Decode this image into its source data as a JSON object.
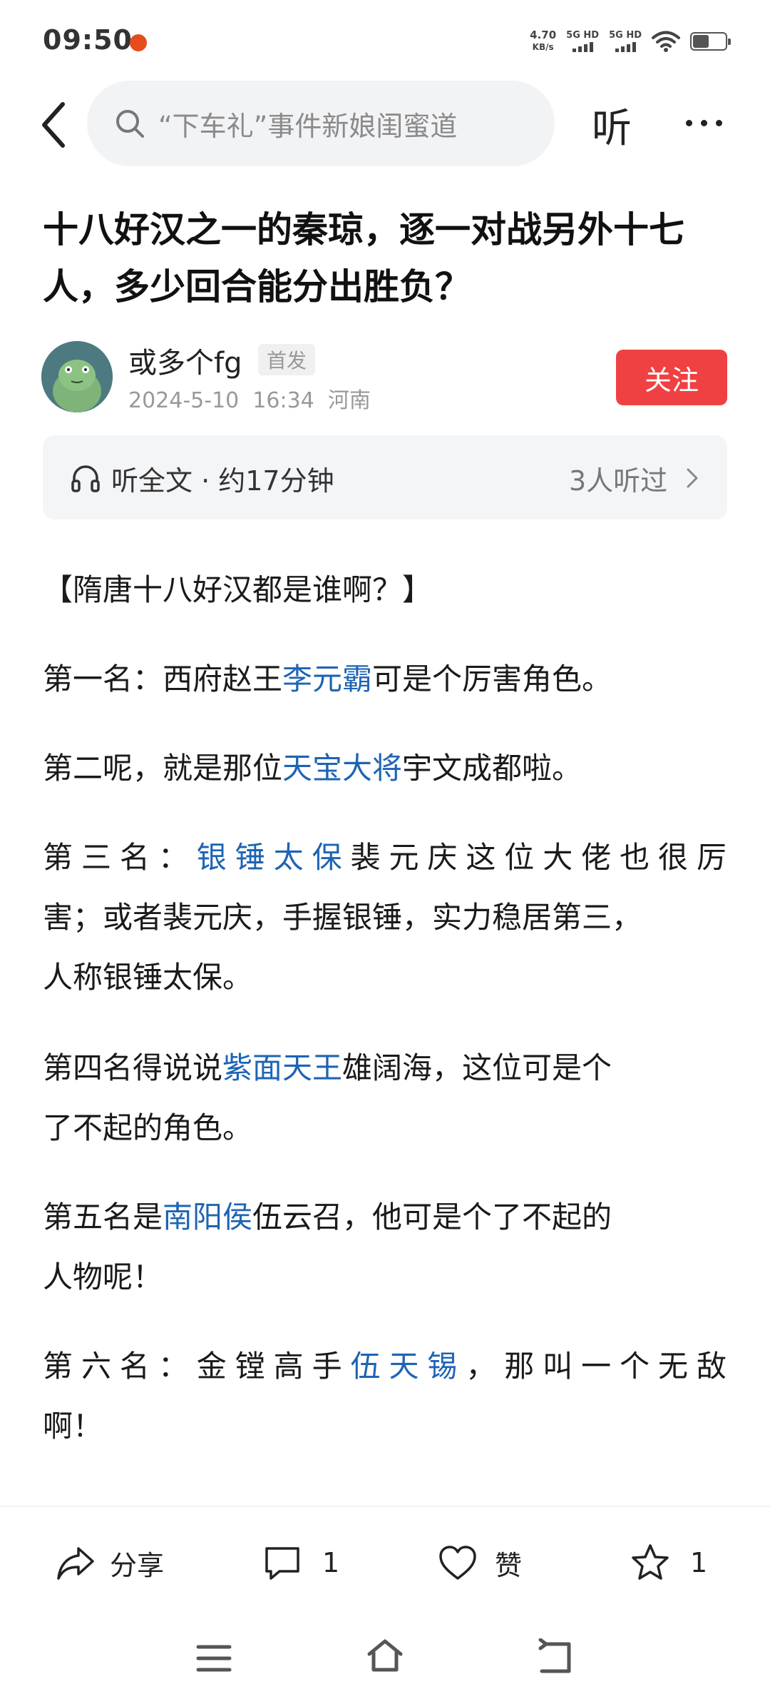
{
  "status": {
    "time": "09:50",
    "speed_value": "4.70",
    "speed_unit": "KB/s",
    "sim1": "5G HD",
    "sim2": "5G HD"
  },
  "nav": {
    "search_text": "“下车礼”事件新娘闺蜜道",
    "listen_label": "听"
  },
  "article": {
    "title": "十八好汉之一的秦琼，逐一对战另外十七人，多少回合能分出胜负？",
    "author": "或多个fg",
    "first_tag": "首发",
    "date": "2024-5-10",
    "time": "16:34",
    "location": "河南",
    "follow_label": "关注"
  },
  "listen_bar": {
    "label": "听全文 · 约17分钟",
    "listeners": "3人听过"
  },
  "body": {
    "heading": "【隋唐十八好汉都是谁啊？】",
    "p1": {
      "pre": "第一名：西府赵王",
      "link": "李元霸",
      "post": "可是个厉害角色。"
    },
    "p2": {
      "pre": "第二呢，就是那位",
      "link": "天宝大将",
      "post": "宇文成都啦。"
    },
    "p3": {
      "line1_pre": "第三名：",
      "line1_link": "银锤太保",
      "line1_post": "裴元庆这位大佬也很厉",
      "line2": "害；或者裴元庆，手握银锤，实力稳居第三，",
      "line3": "人称银锤太保。"
    },
    "p4": {
      "line1_pre": "第四名得说说",
      "line1_link": "紫面天王",
      "line1_post": "雄阔海，这位可是个",
      "line2": "了不起的角色。"
    },
    "p5": {
      "line1_pre": "第五名是",
      "line1_link": "南阳侯",
      "line1_post": "伍云召，他可是个了不起的",
      "line2": "人物呢！"
    },
    "p6": {
      "line1_pre": "第六名：金镗高手",
      "line1_link": "伍天锡",
      "line1_post": "，那叫一个无敌",
      "line2": "啊！"
    }
  },
  "actions": {
    "share_label": "分享",
    "comment_count": "1",
    "like_label": "赞",
    "favorite_count": "1"
  },
  "colors": {
    "follow_bg": "#f04142",
    "link": "#1e64b4",
    "search_bg": "#f2f3f5"
  }
}
